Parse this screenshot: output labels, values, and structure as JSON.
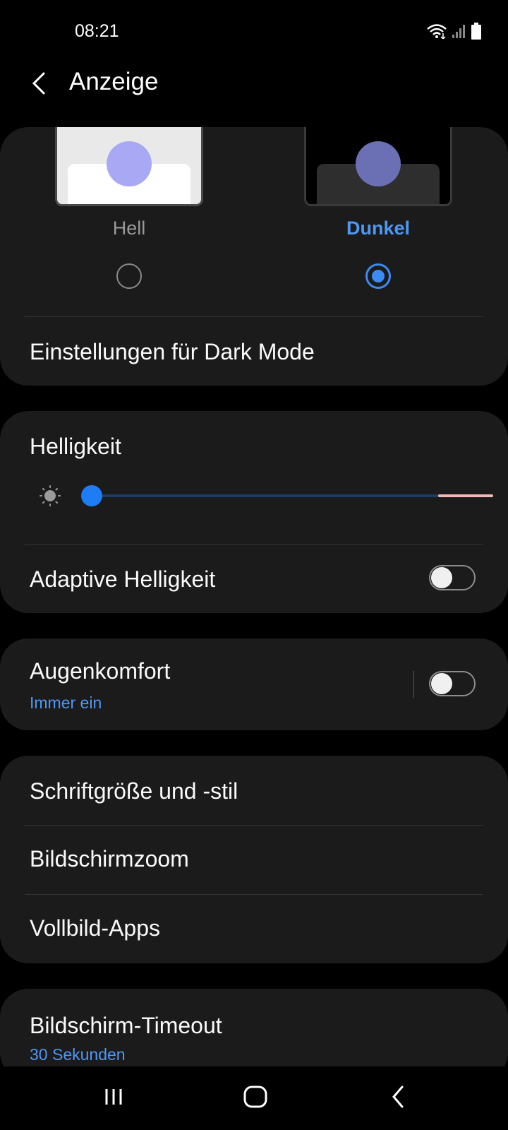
{
  "status_bar": {
    "time": "08:21",
    "icons": [
      "wifi-icon",
      "signal-icon",
      "battery-icon"
    ]
  },
  "header": {
    "title": "Anzeige",
    "back_icon": "chevron-left-icon"
  },
  "theme": {
    "options": [
      {
        "label": "Hell",
        "selected": false
      },
      {
        "label": "Dunkel",
        "selected": true
      }
    ],
    "dark_mode_settings_label": "Einstellungen für Dark Mode"
  },
  "brightness": {
    "label": "Helligkeit",
    "level_percent": 0,
    "icon": "sun-icon"
  },
  "adaptive_brightness": {
    "label": "Adaptive Helligkeit",
    "enabled": false
  },
  "eye_comfort": {
    "label": "Augenkomfort",
    "sub": "Immer ein",
    "enabled": false
  },
  "font_section": {
    "items": [
      {
        "label": "Schriftgröße und -stil"
      },
      {
        "label": "Bildschirmzoom"
      },
      {
        "label": "Vollbild-Apps"
      }
    ]
  },
  "timeout": {
    "label": "Bildschirm-Timeout",
    "sub": "30 Sekunden"
  },
  "nav_bar": {
    "icons": [
      "recent-apps-icon",
      "home-icon",
      "back-icon"
    ]
  },
  "colors": {
    "accent": "#3d8af2",
    "card_bg": "#1b1b1b",
    "background": "#000000"
  }
}
